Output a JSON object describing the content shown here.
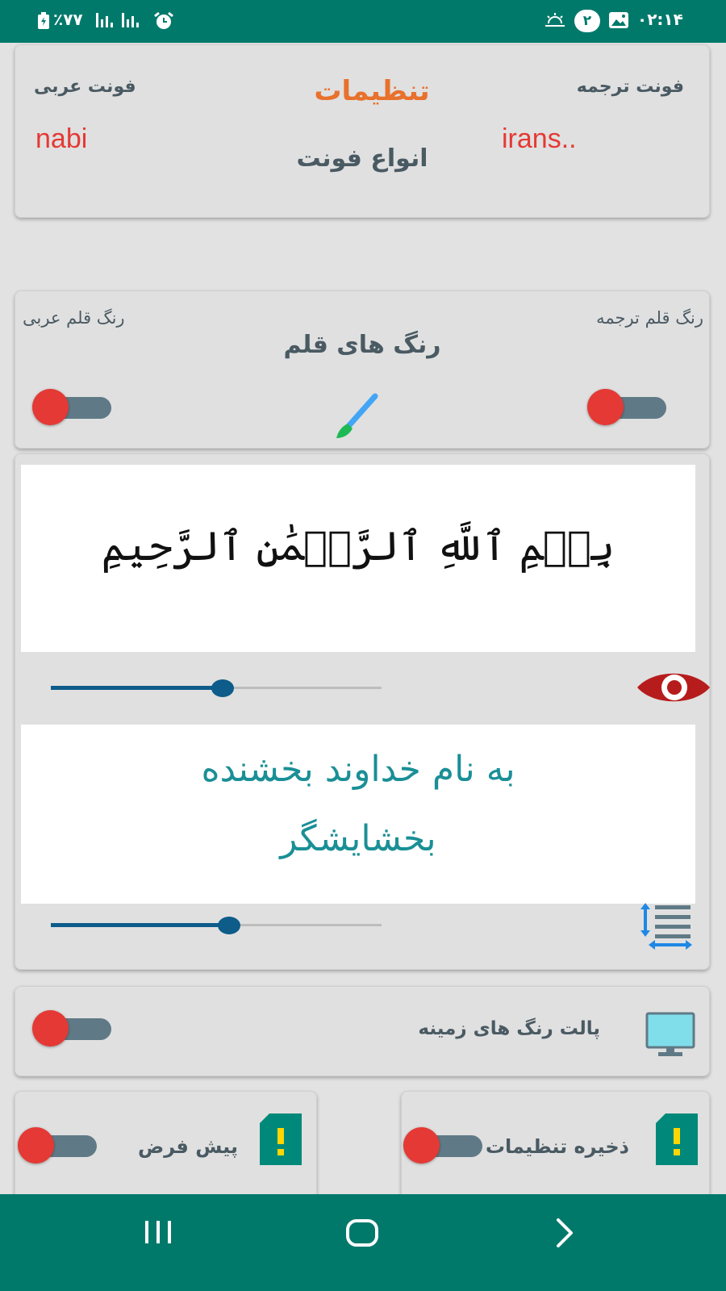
{
  "status_bar": {
    "battery": "٪۷۷",
    "time": "۰۲:۱۴",
    "notification_count": "۲",
    "icons": [
      "battery-icon",
      "signal-icon",
      "signal-icon",
      "alarm-icon",
      "weather-icon",
      "notification-badge-icon",
      "gallery-icon"
    ]
  },
  "fonts_card": {
    "title": "تنظیمات",
    "subtitle": "انواع فونت",
    "arabic_font_label": "فونت عربی",
    "arabic_font_value": "nabi",
    "translation_font_label": "فونت ترجمه",
    "translation_font_value": "irans.."
  },
  "pen_colors_card": {
    "title": "رنگ های قلم",
    "arabic_pen_label": "رنگ قلم عربی",
    "translation_pen_label": "رنگ قلم ترجمه",
    "icon": "paintbrush-icon"
  },
  "preview_card": {
    "arabic_text": "بِسۡمِ ٱللَّهِ ٱلرَّحۡمَٰنِ ٱلرَّحِيمِ",
    "translation_line1": "به نام خداوند بخشنده",
    "translation_line2": "بخشایشگر",
    "arabic_size_level_percent": 52,
    "translation_size_level_percent": 54,
    "eye_icon": "eye-icon",
    "line_spacing_icon": "line-spacing-icon"
  },
  "background_palette": {
    "label": "پالت رنگ های زمینه",
    "icon": "monitor-icon"
  },
  "default_setting": {
    "label": "پیش فرض",
    "icon": "sd-card-alert-icon"
  },
  "save_settings": {
    "label": "ذخیره تنظیمات",
    "icon": "sd-card-alert-icon"
  },
  "colors": {
    "primary": "#00796b",
    "accent_orange": "#e8712c",
    "value_red": "#e53935",
    "label_gray": "#4a5a63",
    "translation_teal": "#1a8f96",
    "slider_blue": "#0d5c8a",
    "eye_red": "#b71c1c"
  },
  "navigation": {
    "recents": "recents-icon",
    "home": "home-icon",
    "back": "back-icon"
  }
}
